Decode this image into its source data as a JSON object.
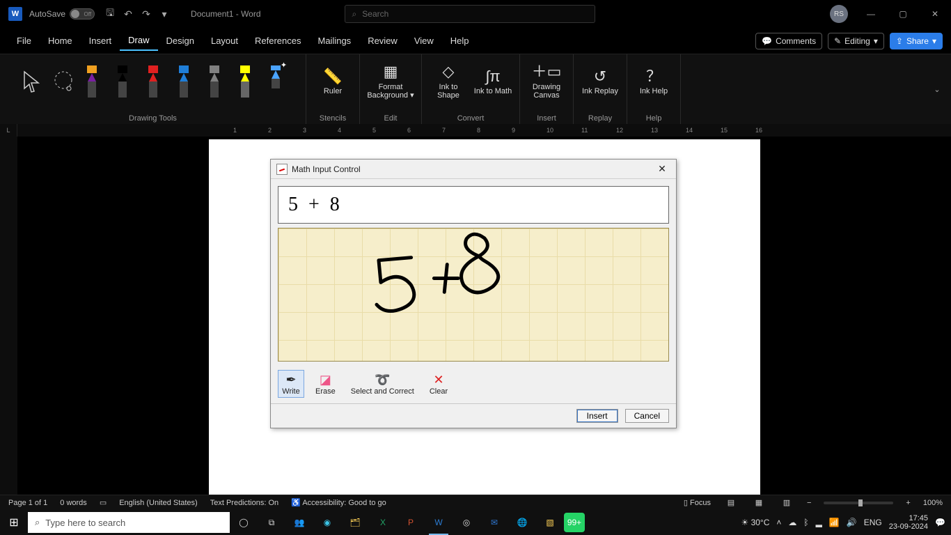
{
  "title": {
    "autosave_label": "AutoSave",
    "autosave_state": "Off",
    "document": "Document1 - Word",
    "search_placeholder": "Search",
    "user_initials": "RS"
  },
  "tabs": [
    "File",
    "Home",
    "Insert",
    "Draw",
    "Design",
    "Layout",
    "References",
    "Mailings",
    "Review",
    "View",
    "Help"
  ],
  "active_tab": "Draw",
  "right_pills": {
    "comments": "Comments",
    "editing": "Editing",
    "share": "Share"
  },
  "ribbon": {
    "groups": {
      "drawing_tools": "Drawing Tools",
      "stencils": "Stencils",
      "edit": "Edit",
      "convert": "Convert",
      "insert": "Insert",
      "replay": "Replay",
      "help": "Help"
    },
    "buttons": {
      "ruler": "Ruler",
      "format_background": "Format Background",
      "ink_to_shape": "Ink to Shape",
      "ink_to_math": "Ink to Math",
      "drawing_canvas": "Drawing Canvas",
      "ink_replay": "Ink Replay",
      "ink_help": "Ink Help"
    },
    "pens": [
      {
        "color": "#f0a020",
        "sub": "#7a1fa2"
      },
      {
        "color": "#000000",
        "sub": "#000000"
      },
      {
        "color": "#e02020",
        "sub": "#e02020"
      },
      {
        "color": "#1f7ed8",
        "sub": "#1f7ed8"
      },
      {
        "color": "#808080",
        "sub": "#808080"
      },
      {
        "color": "#ffff00",
        "sub": "#ffff00",
        "hl": true
      },
      {
        "color": "#4aa3ff",
        "sub": "#4aa3ff",
        "sparkle": true
      }
    ]
  },
  "dialog": {
    "title": "Math Input Control",
    "preview": "5 + 8",
    "tools": {
      "write": "Write",
      "erase": "Erase",
      "select": "Select and Correct",
      "clear": "Clear"
    },
    "insert": "Insert",
    "cancel": "Cancel"
  },
  "status": {
    "page": "Page 1 of 1",
    "words": "0 words",
    "lang": "English (United States)",
    "predictions": "Text Predictions: On",
    "accessibility": "Accessibility: Good to go",
    "focus": "Focus",
    "zoom": "100%"
  },
  "taskbar": {
    "search_placeholder": "Type here to search",
    "weather": "30°C",
    "lang": "ENG",
    "time": "17:45",
    "date": "23-09-2024",
    "badge": "99+"
  }
}
